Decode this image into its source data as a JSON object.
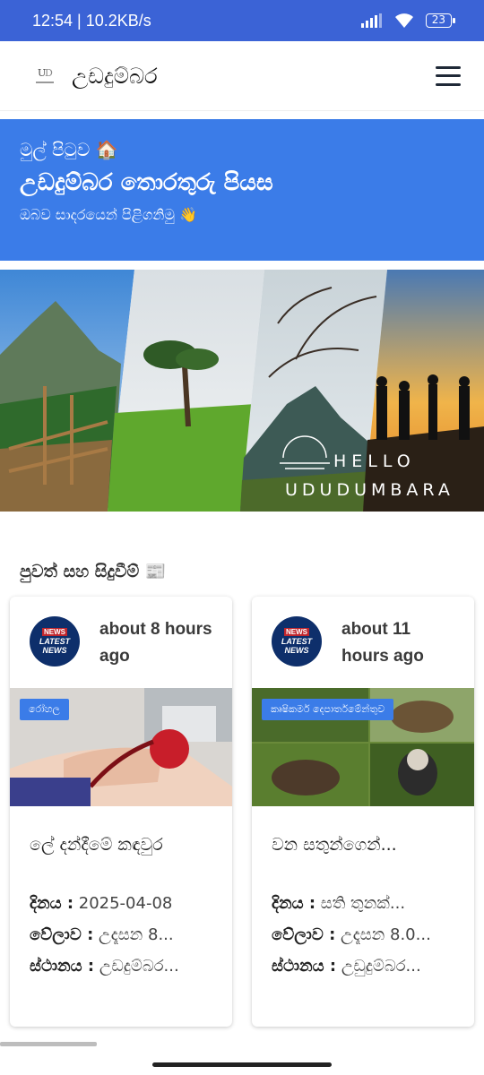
{
  "status": {
    "time": "12:54 | 10.2KB/s",
    "battery": "23"
  },
  "header": {
    "brand": "උඩදුම්බර",
    "logo_icon": "udadumbara-logo-icon",
    "menu_icon": "hamburger-menu-icon"
  },
  "hero": {
    "crumb": "මුල් පිටුව 🏠",
    "title": "උඩදුම්බර තොරතුරු පියස",
    "subtitle": "ඔබව සාදරයෙන් පිළිගනිමු 👋"
  },
  "banner": {
    "line1": "HELLO",
    "line2": "UDUDUMBARA"
  },
  "news": {
    "section_title": "පුවත් සහ සිදුවීම් 📰",
    "avatar_badge": "NEWS",
    "avatar_text": "LATEST NEWS",
    "items": [
      {
        "time": "about 8 hours ago",
        "tag": "රෝහල",
        "title": "ලේ දන්දීමේ කඳවුර",
        "date_label": "දිනය :",
        "date": "2025-04-08",
        "time_label": "වේලාව :",
        "time_value": "උදෑසන 8...",
        "place_label": "ස්ථානය :",
        "place": "උඩදුම්බර..."
      },
      {
        "time": "about 11 hours ago",
        "tag": "කෘෂිකර්ම දෙපාර්තමේන්තුව",
        "title": "වන සතුන්ගෙන්...",
        "date_label": "දිනය :",
        "date": "සති තුනක්...",
        "time_label": "වේලාව :",
        "time_value": "උදෑසන 8.0...",
        "place_label": "ස්ථානය :",
        "place": "උඩුදුම්බර..."
      }
    ]
  },
  "colors": {
    "status_bar": "#3b63d6",
    "hero": "#3b7ce8",
    "tag": "#3b7ce8"
  }
}
